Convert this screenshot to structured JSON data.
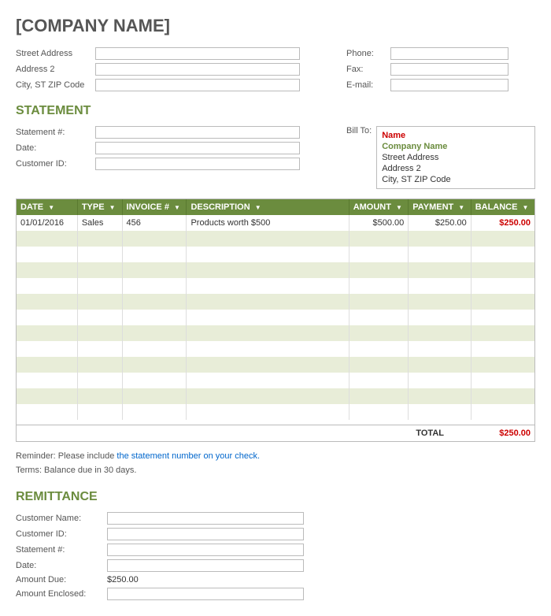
{
  "company": {
    "name": "[COMPANY NAME]",
    "address_label": "Street Address",
    "address2_label": "Address 2",
    "city_label": "City, ST  ZIP Code",
    "phone_label": "Phone:",
    "fax_label": "Fax:",
    "email_label": "E-mail:"
  },
  "statement_section": {
    "title": "STATEMENT",
    "statement_num_label": "Statement #:",
    "date_label": "Date:",
    "customer_id_label": "Customer ID:",
    "bill_to_label": "Bill To:",
    "bill_to": {
      "name": "Name",
      "company": "Company Name",
      "street": "Street Address",
      "address2": "Address 2",
      "city": "City, ST  ZIP Code"
    }
  },
  "table": {
    "columns": [
      {
        "key": "date",
        "label": "DATE"
      },
      {
        "key": "type",
        "label": "TYPE"
      },
      {
        "key": "invoice",
        "label": "INVOICE #"
      },
      {
        "key": "description",
        "label": "DESCRIPTION"
      },
      {
        "key": "amount",
        "label": "AMOUNT"
      },
      {
        "key": "payment",
        "label": "PAYMENT"
      },
      {
        "key": "balance",
        "label": "BALANCE"
      }
    ],
    "rows": [
      {
        "date": "01/01/2016",
        "type": "Sales",
        "invoice": "456",
        "description": "Products worth $500",
        "amount": "$500.00",
        "payment": "$250.00",
        "balance": "$250.00"
      },
      {
        "date": "",
        "type": "",
        "invoice": "",
        "description": "",
        "amount": "",
        "payment": "",
        "balance": ""
      },
      {
        "date": "",
        "type": "",
        "invoice": "",
        "description": "",
        "amount": "",
        "payment": "",
        "balance": ""
      },
      {
        "date": "",
        "type": "",
        "invoice": "",
        "description": "",
        "amount": "",
        "payment": "",
        "balance": ""
      },
      {
        "date": "",
        "type": "",
        "invoice": "",
        "description": "",
        "amount": "",
        "payment": "",
        "balance": ""
      },
      {
        "date": "",
        "type": "",
        "invoice": "",
        "description": "",
        "amount": "",
        "payment": "",
        "balance": ""
      },
      {
        "date": "",
        "type": "",
        "invoice": "",
        "description": "",
        "amount": "",
        "payment": "",
        "balance": ""
      },
      {
        "date": "",
        "type": "",
        "invoice": "",
        "description": "",
        "amount": "",
        "payment": "",
        "balance": ""
      },
      {
        "date": "",
        "type": "",
        "invoice": "",
        "description": "",
        "amount": "",
        "payment": "",
        "balance": ""
      },
      {
        "date": "",
        "type": "",
        "invoice": "",
        "description": "",
        "amount": "",
        "payment": "",
        "balance": ""
      },
      {
        "date": "",
        "type": "",
        "invoice": "",
        "description": "",
        "amount": "",
        "payment": "",
        "balance": ""
      },
      {
        "date": "",
        "type": "",
        "invoice": "",
        "description": "",
        "amount": "",
        "payment": "",
        "balance": ""
      },
      {
        "date": "",
        "type": "",
        "invoice": "",
        "description": "",
        "amount": "",
        "payment": "",
        "balance": ""
      }
    ],
    "total_label": "TOTAL",
    "total_value": "$250.00"
  },
  "reminder": {
    "line1_prefix": "Reminder: Please include ",
    "line1_link": "the statement number on your check.",
    "line2": "Terms: Balance due in 30 days."
  },
  "remittance": {
    "title": "REMITTANCE",
    "fields": [
      {
        "label": "Customer Name:",
        "value": ""
      },
      {
        "label": "Customer ID:",
        "value": ""
      },
      {
        "label": "Statement #:",
        "value": ""
      },
      {
        "label": "Date:",
        "value": ""
      },
      {
        "label": "Amount Due:",
        "value": "$250.00",
        "static": true
      },
      {
        "label": "Amount Enclosed:",
        "value": ""
      }
    ]
  }
}
